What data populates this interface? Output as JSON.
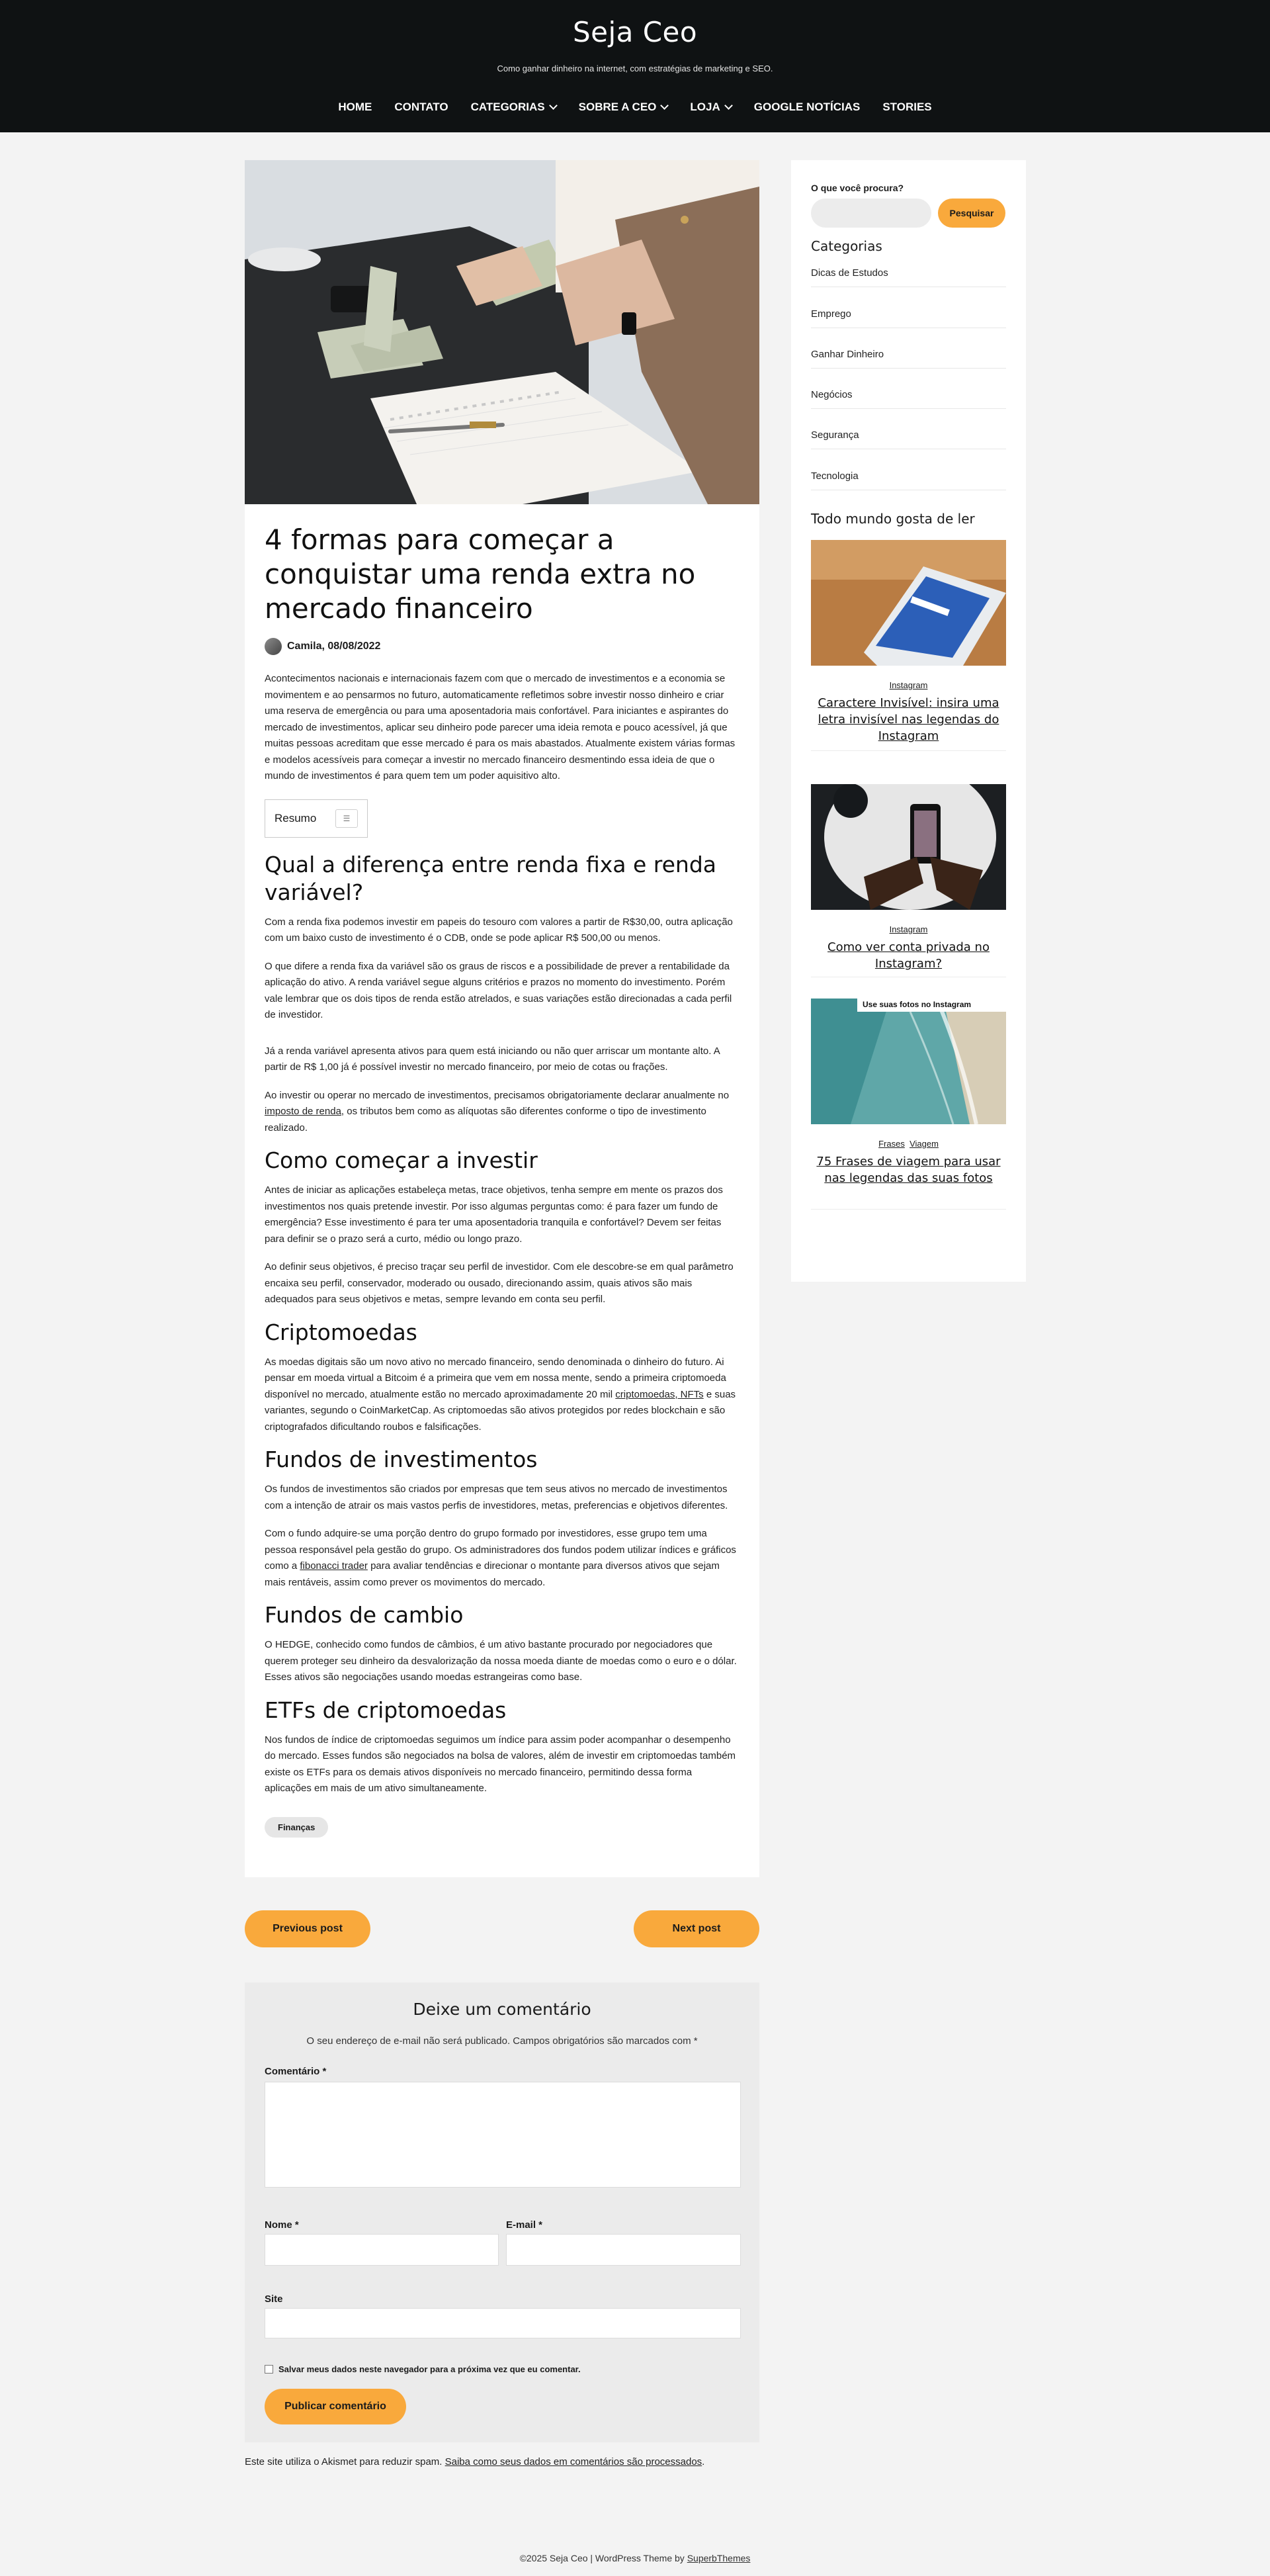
{
  "site": {
    "title": "Seja Ceo",
    "tagline": "Como ganhar dinheiro na internet, com estratégias de marketing e SEO."
  },
  "nav": {
    "home": "HOME",
    "contato": "CONTATO",
    "categorias": "CATEGORIAS",
    "sobre": "SOBRE A CEO",
    "loja": "LOJA",
    "google": "GOOGLE NOTÍCIAS",
    "stories": "STORIES"
  },
  "post": {
    "title": "4 formas para começar a conquistar uma renda extra no mercado financeiro",
    "author_date": "Camila, 08/08/2022",
    "intro": "Acontecimentos nacionais e internacionais fazem com que o mercado de investimentos e a economia se movimentem e ao pensarmos no futuro, automaticamente refletimos sobre investir nosso dinheiro e criar uma reserva de emergência ou para uma aposentadoria mais confortável. Para iniciantes e aspirantes do mercado de investimentos, aplicar seu dinheiro pode parecer uma ideia remota e pouco acessível, já que muitas pessoas acreditam que esse mercado é para os mais abastados. Atualmente existem várias formas e modelos acessíveis para começar a investir no mercado financeiro desmentindo essa ideia de que o mundo de investimentos é para quem tem um poder aquisitivo alto.",
    "toc_label": "Resumo",
    "h_diferenca": "Qual a diferença entre renda fixa e renda variável?",
    "p_diferenca_1": "Com a renda fixa podemos investir em papeis do tesouro com valores a partir de R$30,00, outra aplicação com um baixo custo de investimento é o CDB, onde se pode aplicar R$ 500,00 ou menos.",
    "p_diferenca_2": "O que difere a renda fixa da variável são os graus de riscos e a possibilidade de prever a rentabilidade da aplicação do ativo. A renda variável segue alguns critérios e prazos no momento do investimento. Porém vale lembrar que os dois tipos de renda estão atrelados, e suas variações estão direcionadas a cada perfil de investidor.",
    "p_diferenca_3": "Já a renda variável apresenta ativos para quem está iniciando ou não quer arriscar um montante alto. A partir de R$ 1,00 já é possível investir no mercado financeiro, por meio de cotas ou frações.",
    "p_diferenca_4a": "Ao investir ou operar no mercado de investimentos, precisamos obrigatoriamente declarar anualmente no ",
    "p_diferenca_4_link": "imposto de renda",
    "p_diferenca_4b": ", os tributos bem como as alíquotas são diferentes conforme o tipo de investimento realizado.",
    "h_comecar": "Como começar a investir",
    "p_comecar_1": "Antes de iniciar as aplicações estabeleça metas, trace objetivos, tenha sempre em mente os prazos dos investimentos nos quais pretende investir. Por isso algumas perguntas como: é para fazer um fundo de emergência? Esse investimento é para ter uma aposentadoria tranquila e confortável? Devem ser feitas para definir se o prazo será a curto, médio ou longo prazo.",
    "p_comecar_2": "Ao definir seus objetivos, é preciso traçar seu perfil de investidor. Com ele descobre-se em qual parâmetro encaixa seu perfil, conservador, moderado ou ousado, direcionando assim, quais ativos são mais adequados para seus objetivos e metas, sempre levando em conta seu perfil.",
    "h_cripto": "Criptomoedas",
    "p_cripto_a": "As moedas digitais são um novo ativo no mercado financeiro, sendo denominada o dinheiro do futuro. Ai pensar em moeda virtual a Bitcoim é a primeira que vem em nossa mente, sendo a primeira criptomoeda disponível no mercado, atualmente estão no mercado aproximadamente 20 mil ",
    "p_cripto_link": "criptomoedas, NFTs",
    "p_cripto_b": " e suas variantes, segundo o CoinMarketCap. As criptomoedas são ativos protegidos por redes blockchain e são criptografados dificultando roubos e falsificações.",
    "h_fundos": "Fundos de investimentos",
    "p_fundos_1": "Os fundos de investimentos são criados por empresas que tem seus ativos no mercado de investimentos com a intenção de atrair os mais vastos perfis de investidores, metas, preferencias e objetivos diferentes.",
    "p_fundos_2a": "Com o fundo adquire-se uma porção dentro do grupo formado por investidores, esse grupo tem uma pessoa responsável pela gestão do grupo. Os administradores dos fundos podem utilizar índices e gráficos como a ",
    "p_fundos_2_link": "fibonacci trader",
    "p_fundos_2b": " para avaliar tendências e direcionar o montante para diversos ativos que sejam mais rentáveis, assim como prever os movimentos do mercado.",
    "h_cambio": "Fundos de cambio",
    "p_cambio": "O HEDGE, conhecido como fundos de câmbios, é um ativo bastante procurado por negociadores que querem proteger seu dinheiro da desvalorização da nossa moeda diante de moedas como o euro e o dólar. Esses ativos são negociações usando moedas estrangeiras como base.",
    "h_etf": "ETFs de criptomoedas",
    "p_etf": "Nos fundos de índice de criptomoedas seguimos um índice para assim poder acompanhar o desempenho do mercado. Esses fundos são negociados na bolsa de valores, além de investir em criptomoedas também existe os ETFs para os demais ativos disponíveis no mercado financeiro, permitindo dessa forma aplicações em mais de um ativo simultaneamente.",
    "tag": "Finanças"
  },
  "post_nav": {
    "previous": "Previous post",
    "next": "Next post"
  },
  "comments": {
    "title": "Deixe um comentário",
    "notes": "O seu endereço de e-mail não será publicado. Campos obrigatórios são marcados com *",
    "comment_label": "Comentário *",
    "name_label": "Nome *",
    "email_label": "E-mail *",
    "site_label": "Site",
    "save_label": "Salvar meus dados neste navegador para a próxima vez que eu comentar.",
    "submit": "Publicar comentário"
  },
  "akismet": {
    "text": "Este site utiliza o Akismet para reduzir spam. ",
    "link": "Saiba como seus dados em comentários são processados",
    "end": "."
  },
  "sidebar": {
    "search_label": "O que você procura?",
    "search_button": "Pesquisar",
    "categories_title": "Categorias",
    "categories": [
      "Dicas de Estudos",
      "Emprego",
      "Ganhar Dinheiro",
      "Negócios",
      "Segurança",
      "Tecnologia"
    ],
    "popular_title": "Todo mundo gosta de ler",
    "popular": [
      {
        "category": "Instagram",
        "title": "Caractere Invisível: insira uma letra invisível nas legendas do Instagram"
      },
      {
        "category": "Instagram",
        "title": "Como ver conta privada no Instagram?"
      },
      {
        "category_1": "Frases",
        "category_2": "Viagem",
        "overlay": "Use suas fotos no Instagram",
        "title": "75 Frases de viagem para usar nas legendas das suas fotos"
      }
    ]
  },
  "footer": {
    "credit": "©2025 Seja Ceo | WordPress Theme by ",
    "credit_link": "SuperbThemes"
  }
}
